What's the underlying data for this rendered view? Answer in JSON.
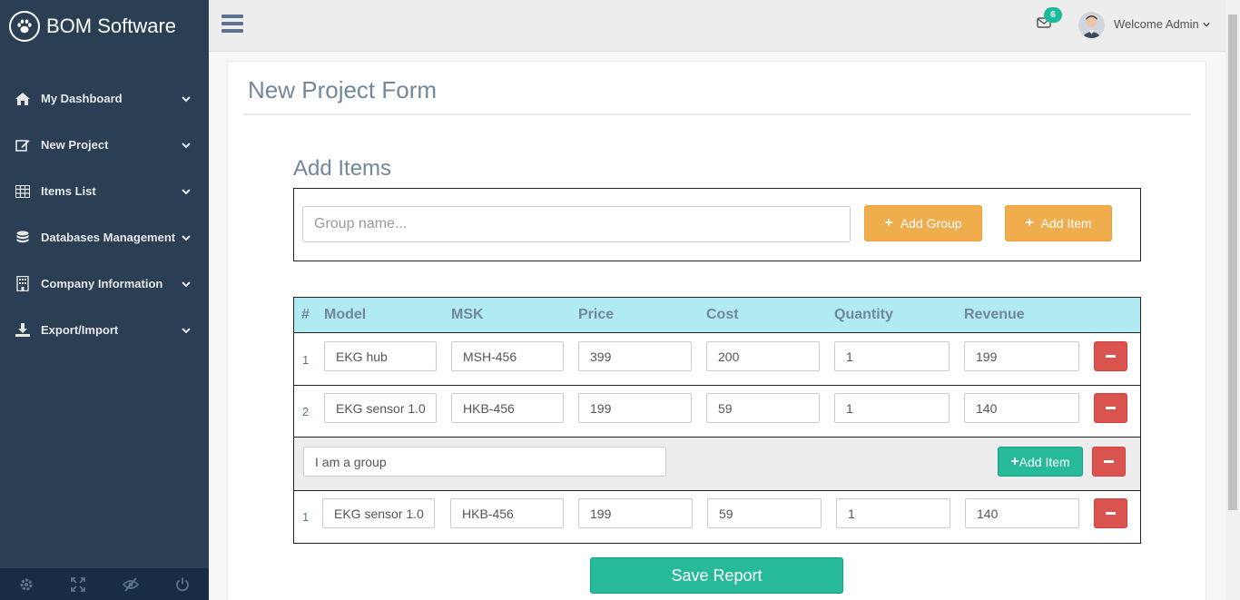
{
  "brand": {
    "name": "BOM Software",
    "logo_icon": "paw-icon"
  },
  "sidebar": {
    "items": [
      {
        "label": "My Dashboard",
        "icon": "home-icon"
      },
      {
        "label": "New Project",
        "icon": "edit-icon"
      },
      {
        "label": "Items List",
        "icon": "table-icon"
      },
      {
        "label": "Databases Management",
        "icon": "database-icon"
      },
      {
        "label": "Company Information",
        "icon": "building-icon"
      },
      {
        "label": "Export/Import",
        "icon": "download-icon"
      }
    ],
    "footer_icons": [
      "settings-icon",
      "fullscreen-icon",
      "eye-slash-icon",
      "power-icon"
    ]
  },
  "topnav": {
    "mail_count": "6",
    "welcome": "Welcome Admin"
  },
  "panel": {
    "title": "New Project Form",
    "section_title": "Add Items",
    "group_input_placeholder": "Group name...",
    "add_group_label": "Add Group",
    "add_item_label": "Add Item"
  },
  "table": {
    "headers": [
      "#",
      "Model",
      "MSK",
      "Price",
      "Cost",
      "Quantity",
      "Revenue"
    ],
    "rows": [
      {
        "index": "1",
        "model": "EKG hub",
        "msk": "MSH-456",
        "price": "399",
        "cost": "200",
        "quantity": "1",
        "revenue": "199"
      },
      {
        "index": "2",
        "model": "EKG sensor 1.0",
        "msk": "HKB-456",
        "price": "199",
        "cost": "59",
        "quantity": "1",
        "revenue": "140"
      }
    ],
    "group": {
      "name": "I am a group",
      "add_item_label": "Add Item",
      "rows": [
        {
          "index": "1",
          "model": "EKG sensor 1.0",
          "msk": "HKB-456",
          "price": "199",
          "cost": "59",
          "quantity": "1",
          "revenue": "140"
        }
      ]
    }
  },
  "save_label": "Save Report",
  "colors": {
    "sidebar_bg": "#2a3f54",
    "header_row_bg": "#b0eaf3",
    "accent_green": "#26b99a",
    "accent_orange": "#f0ad4e",
    "danger_red": "#d9534f"
  }
}
